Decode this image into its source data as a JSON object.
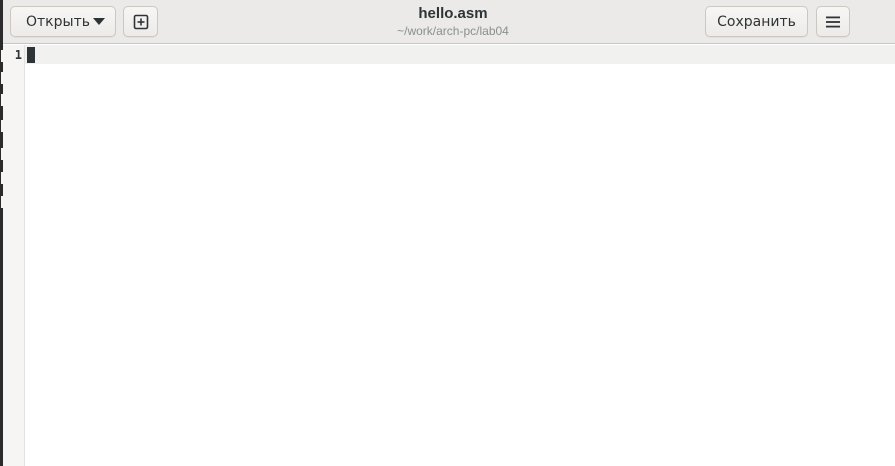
{
  "header": {
    "open_label": "Открыть",
    "title": "hello.asm",
    "subtitle": "~/work/arch-pc/lab04",
    "save_label": "Сохранить"
  },
  "editor": {
    "line_numbers": [
      "1"
    ],
    "current_line": 1,
    "content": ""
  },
  "icons": {
    "open_menu": "chevron-down-icon",
    "new_tab": "new-document-plus-icon",
    "main_menu": "hamburger-menu-icon"
  },
  "colors": {
    "headerbar_bg": "#ebeae8",
    "gutter_bg": "#f6f5f4",
    "current_line_bg": "#f1f1f0",
    "text": "#2e3436",
    "subtitle_text": "#8b8e8f"
  }
}
